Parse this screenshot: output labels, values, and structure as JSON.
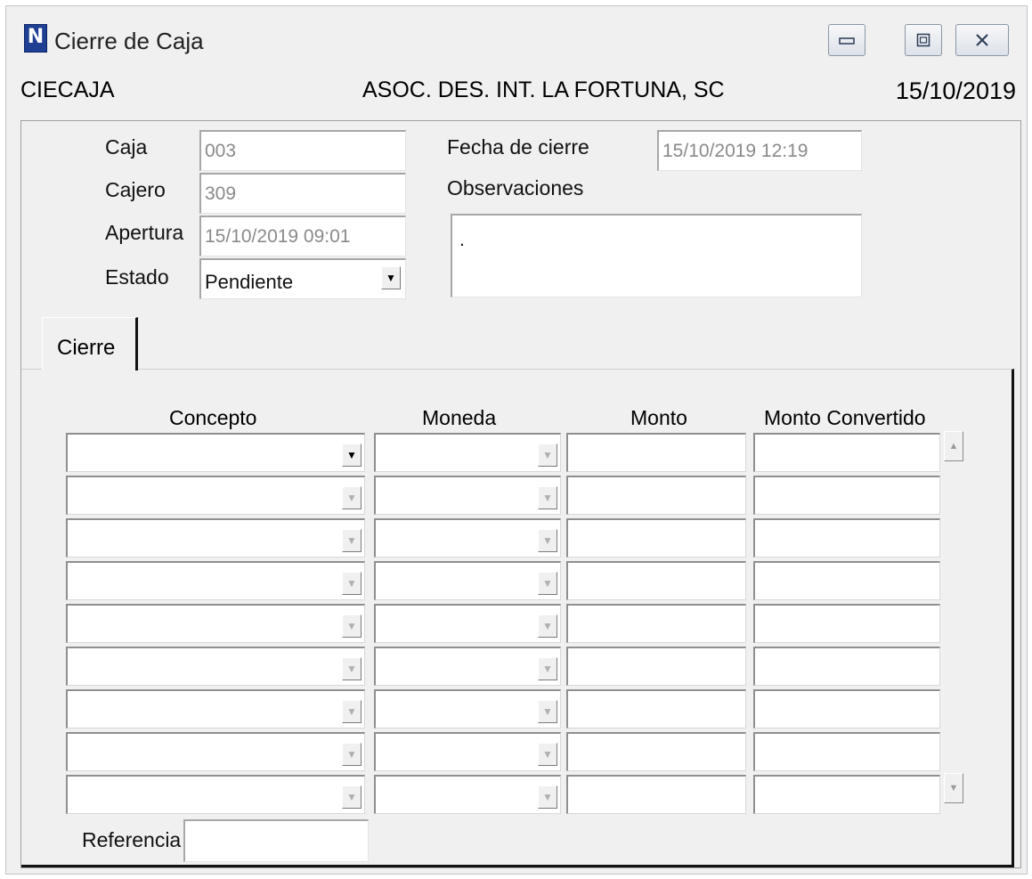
{
  "window": {
    "icon_letter": "N",
    "title": "Cierre de Caja",
    "accent": "#1f3f93"
  },
  "header": {
    "form_code": "CIECAJA",
    "organization": "ASOC. DES. INT. LA FORTUNA, SC",
    "date": "15/10/2019"
  },
  "fields": {
    "caja": {
      "label": "Caja",
      "value": "003"
    },
    "cajero": {
      "label": "Cajero",
      "value": "309"
    },
    "apertura": {
      "label": "Apertura",
      "value": "15/10/2019  09:01"
    },
    "estado": {
      "label": "Estado",
      "value": "Pendiente"
    },
    "fecha_cierre": {
      "label": "Fecha de cierre",
      "value": "15/10/2019  12:19"
    },
    "observaciones": {
      "label": "Observaciones",
      "value": "."
    }
  },
  "tabs": [
    {
      "label": "Cierre",
      "active": true
    }
  ],
  "grid": {
    "columns": [
      "Concepto",
      "Moneda",
      "Monto",
      "Monto Convertido"
    ],
    "rows": [
      {
        "concepto": "",
        "moneda": "",
        "monto": "",
        "monto_convertido": ""
      },
      {
        "concepto": "",
        "moneda": "",
        "monto": "",
        "monto_convertido": ""
      },
      {
        "concepto": "",
        "moneda": "",
        "monto": "",
        "monto_convertido": ""
      },
      {
        "concepto": "",
        "moneda": "",
        "monto": "",
        "monto_convertido": ""
      },
      {
        "concepto": "",
        "moneda": "",
        "monto": "",
        "monto_convertido": ""
      },
      {
        "concepto": "",
        "moneda": "",
        "monto": "",
        "monto_convertido": ""
      },
      {
        "concepto": "",
        "moneda": "",
        "monto": "",
        "monto_convertido": ""
      },
      {
        "concepto": "",
        "moneda": "",
        "monto": "",
        "monto_convertido": ""
      },
      {
        "concepto": "",
        "moneda": "",
        "monto": "",
        "monto_convertido": ""
      }
    ]
  },
  "referencia": {
    "label": "Referencia",
    "value": ""
  },
  "icons": {
    "minimize": "minimize-icon",
    "maximize": "maximize-icon",
    "close": "close-icon",
    "dropdown": "chevron-down-icon",
    "scroll_up": "scroll-up-icon",
    "scroll_down": "scroll-down-icon"
  }
}
